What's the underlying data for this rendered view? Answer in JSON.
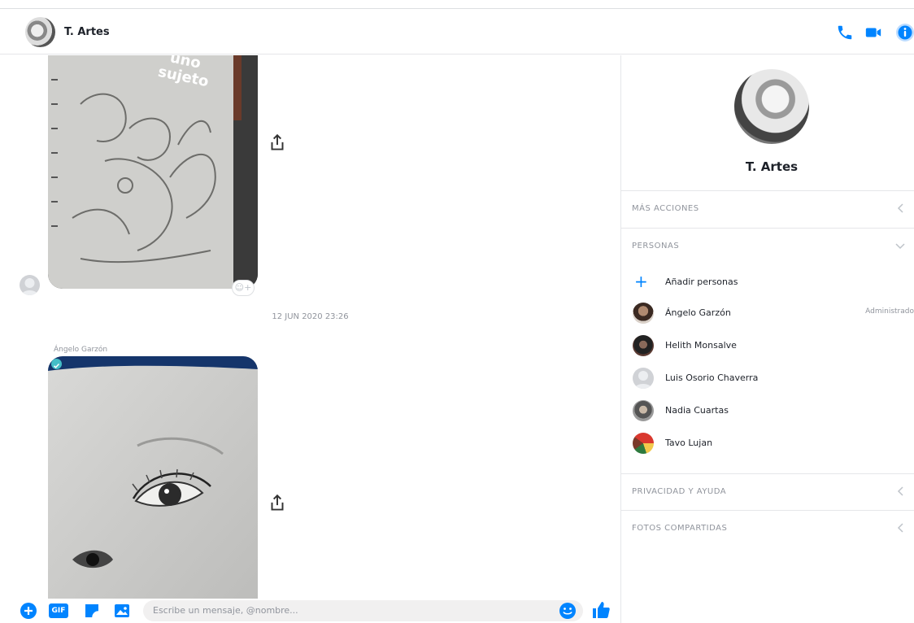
{
  "header": {
    "title": "T. Artes"
  },
  "conversation": {
    "timestamp": "12 JUN 2020 23:26",
    "sender_name": "Ángelo Garzón",
    "image1_caption": "sujeto",
    "image1_caption_top": "uno"
  },
  "composer": {
    "placeholder": "Escribe un mensaje, @nombre...",
    "gif_label": "GIF"
  },
  "sidebar": {
    "name": "T. Artes",
    "sections": {
      "more_actions": "MÁS ACCIONES",
      "people": "PERSONAS",
      "privacy": "PRIVACIDAD Y AYUDA",
      "photos": "FOTOS COMPARTIDAS"
    },
    "add_people": "Añadir personas",
    "people": [
      {
        "name": "Ángelo Garzón",
        "role": "Administrado"
      },
      {
        "name": "Helith Monsalve",
        "role": ""
      },
      {
        "name": "Luis Osorio Chaverra",
        "role": ""
      },
      {
        "name": "Nadia Cuartas",
        "role": ""
      },
      {
        "name": "Tavo Lujan",
        "role": ""
      }
    ]
  },
  "colors": {
    "accent": "#0084ff",
    "seen": "#44bec7"
  }
}
